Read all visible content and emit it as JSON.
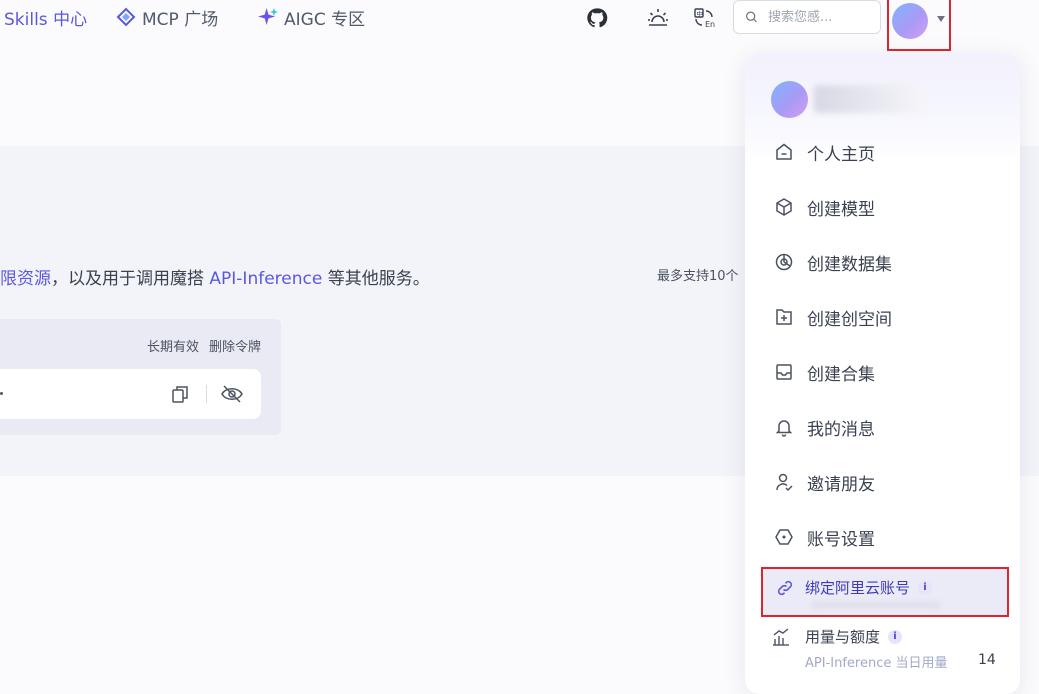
{
  "nav": {
    "skills_label": "Skills 中心",
    "mcp_label": "MCP 广场",
    "aigc_label": "AIGC 专区",
    "search_placeholder": "搜索您感..."
  },
  "content": {
    "desc_part1": "限资源",
    "desc_part2": "，以及用于调用魔搭 ",
    "desc_highlight": "API-Inference",
    "desc_part3": " 等其他服务。",
    "max_note": "最多支持10个",
    "token_validity": "长期有效",
    "token_delete": "删除令牌"
  },
  "dropdown": {
    "items": [
      {
        "label": "个人主页",
        "icon": "home-icon"
      },
      {
        "label": "创建模型",
        "icon": "cube-icon"
      },
      {
        "label": "创建数据集",
        "icon": "pie-chart-icon"
      },
      {
        "label": "创建创空间",
        "icon": "space-add-icon"
      },
      {
        "label": "创建合集",
        "icon": "collection-icon"
      },
      {
        "label": "我的消息",
        "icon": "bell-icon"
      },
      {
        "label": "邀请朋友",
        "icon": "invite-user-icon"
      },
      {
        "label": "账号设置",
        "icon": "settings-hex-icon"
      }
    ],
    "bind_label": "绑定阿里云账号",
    "bind_info": "i",
    "usage_label": "用量与额度",
    "usage_info": "i",
    "usage_sub": "API-Inference 当日用量",
    "usage_value": "14"
  },
  "colors": {
    "accent": "#5b57e0",
    "highlight_border": "#e0242e"
  }
}
